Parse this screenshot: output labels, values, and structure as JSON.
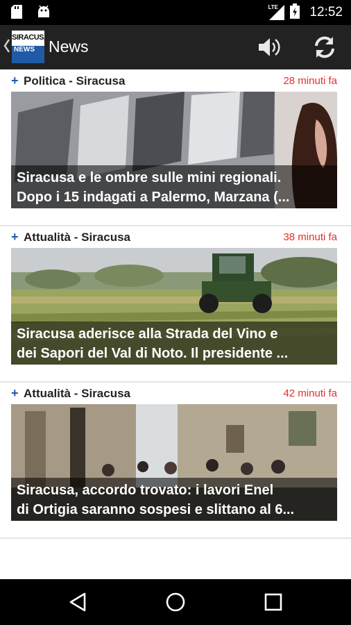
{
  "status_bar": {
    "time": "12:52",
    "network": "LTE",
    "icons": [
      "sd-card-icon",
      "android-icon",
      "signal-icon",
      "battery-icon"
    ]
  },
  "action_bar": {
    "logo_top": "SIRACUSA",
    "logo_bottom": "NEWS",
    "title": "News",
    "icons": [
      "back-chevron-icon",
      "speaker-icon",
      "refresh-icon"
    ]
  },
  "colors": {
    "action_bar_bg": "#222222",
    "accent_blue": "#1f5aa6",
    "time_red": "#e0302a"
  },
  "feed": [
    {
      "category": "Politica - Siracusa",
      "time": "28 minuti fa",
      "title_line1": "Siracusa e le ombre sulle mini regionali.",
      "title_line2": "Dopo i 15 indagati a Palermo, Marzana (..."
    },
    {
      "category": "Attualità - Siracusa",
      "time": "38 minuti fa",
      "title_line1": "Siracusa aderisce alla Strada del Vino e",
      "title_line2": "dei Sapori del Val di Noto. Il presidente ..."
    },
    {
      "category": "Attualità - Siracusa",
      "time": "42 minuti fa",
      "title_line1": "Siracusa, accordo trovato: i lavori Enel",
      "title_line2": "di Ortigia saranno sospesi e slittano al 6..."
    }
  ],
  "nav_bar": {
    "icons": [
      "back-triangle-icon",
      "home-circle-icon",
      "recents-square-icon"
    ]
  }
}
